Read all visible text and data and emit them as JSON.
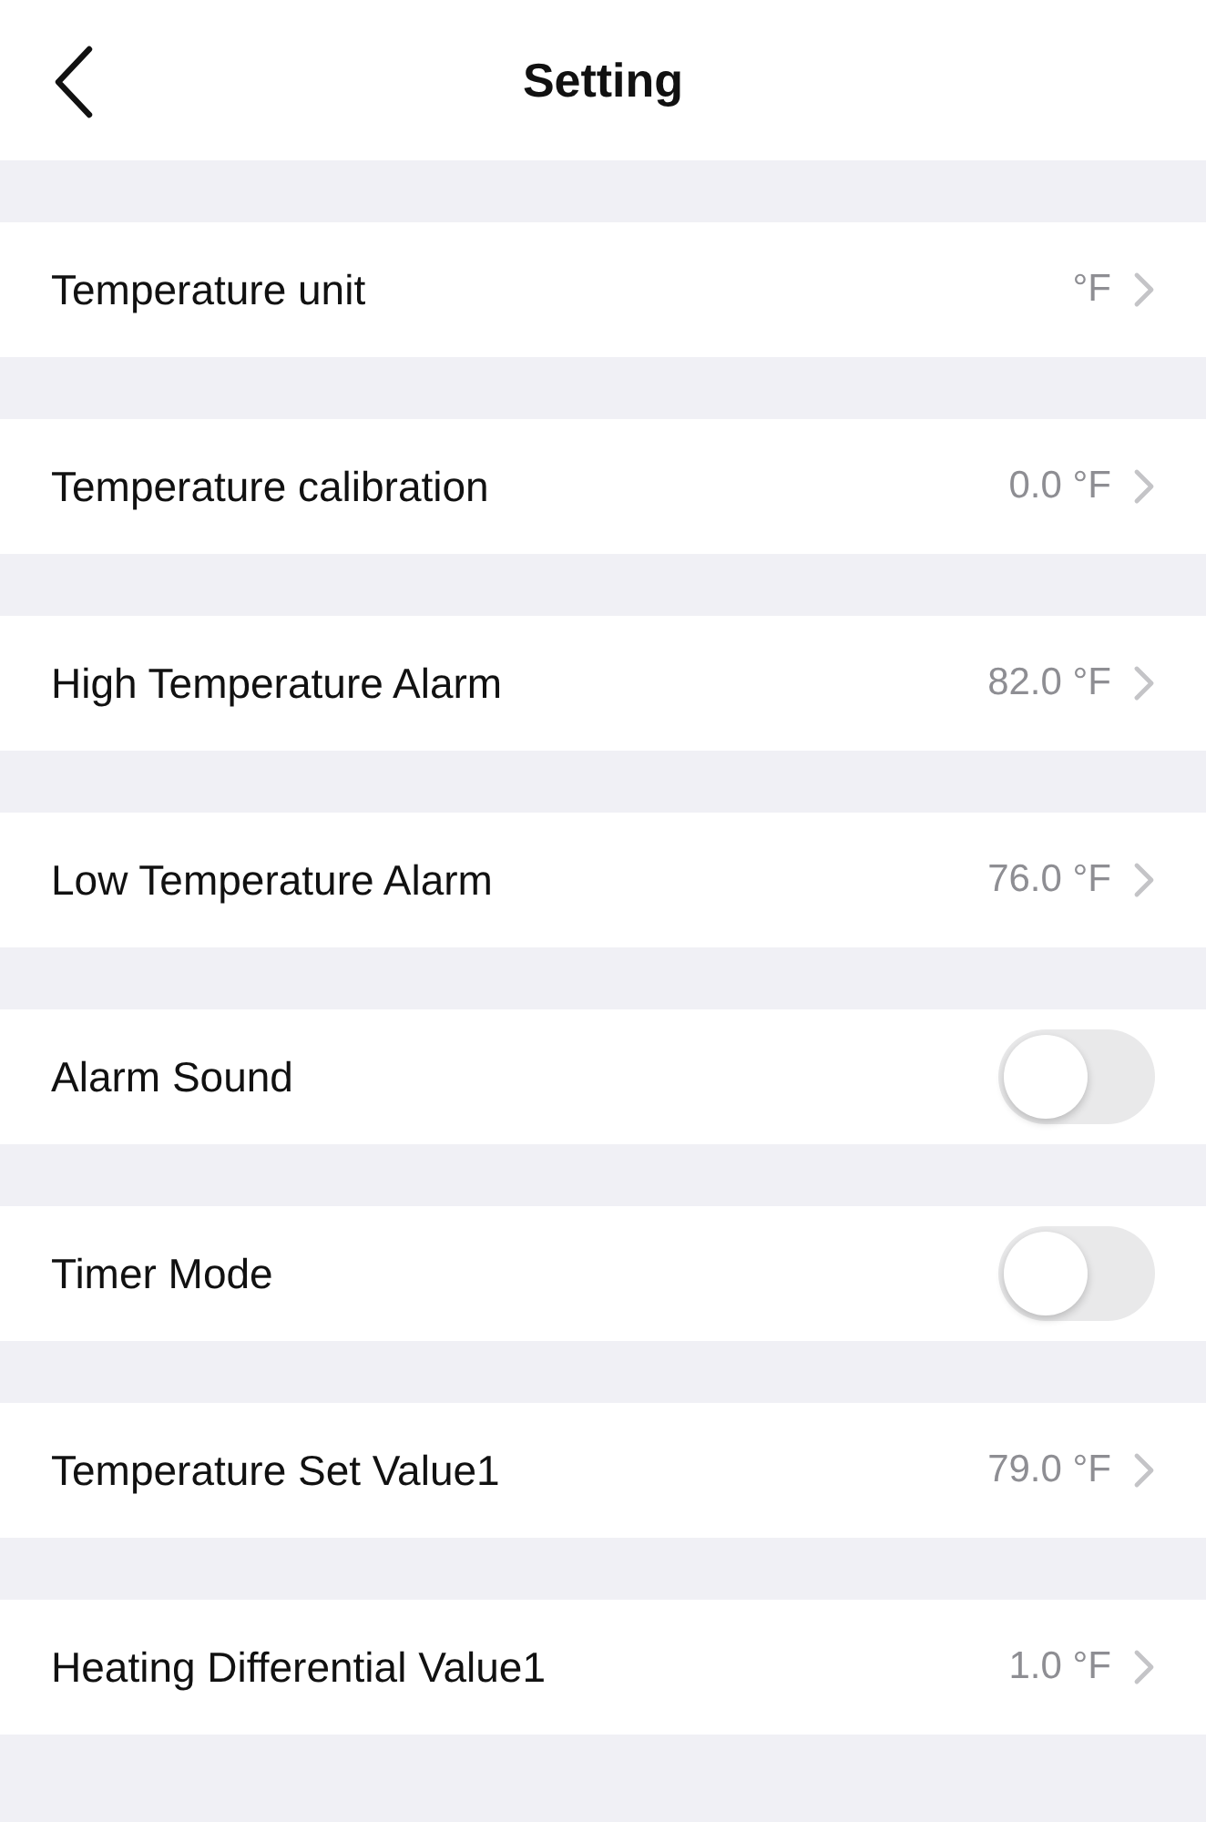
{
  "header": {
    "title": "Setting"
  },
  "rows": [
    {
      "kind": "value",
      "label": "Temperature unit",
      "value": "°F"
    },
    {
      "kind": "value",
      "label": "Temperature calibration",
      "value": "0.0 °F"
    },
    {
      "kind": "value",
      "label": "High Temperature Alarm",
      "value": "82.0 °F"
    },
    {
      "kind": "value",
      "label": "Low Temperature Alarm",
      "value": "76.0 °F"
    },
    {
      "kind": "toggle",
      "label": "Alarm Sound",
      "on": false
    },
    {
      "kind": "toggle",
      "label": "Timer Mode",
      "on": false
    },
    {
      "kind": "value",
      "label": "Temperature Set Value1",
      "value": "79.0 °F"
    },
    {
      "kind": "value",
      "label": "Heating Differential Value1",
      "value": "1.0 °F"
    }
  ]
}
